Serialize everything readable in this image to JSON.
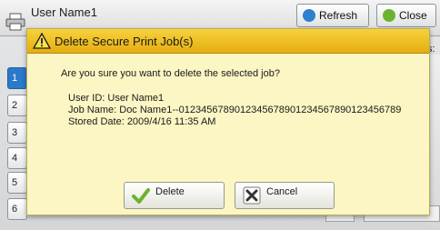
{
  "background": {
    "title": "User Name1",
    "refresh_label": "Refresh",
    "close_label": "Close",
    "side_label": "s:",
    "list_numbers": [
      "1",
      "2",
      "3",
      "4",
      "5",
      "6"
    ]
  },
  "dialog": {
    "title": "Delete Secure Print Job(s)",
    "question": "Are you sure you want to delete the selected job?",
    "user_id": "User ID: User Name1",
    "job_name": "Job Name: Doc Name1--0123456789012345678901234567890123456789",
    "stored_date": "Stored Date: 2009/4/16 11:35 AM",
    "delete_label": "Delete",
    "cancel_label": "Cancel"
  },
  "colors": {
    "titlebar": "#f0c025",
    "dialog_bg": "#fbf6c4",
    "selected_row": "#2b79c9"
  },
  "icons": {
    "window": "printer-icon",
    "title": "warning-icon",
    "delete": "checkmark-icon",
    "cancel": "x-icon"
  }
}
